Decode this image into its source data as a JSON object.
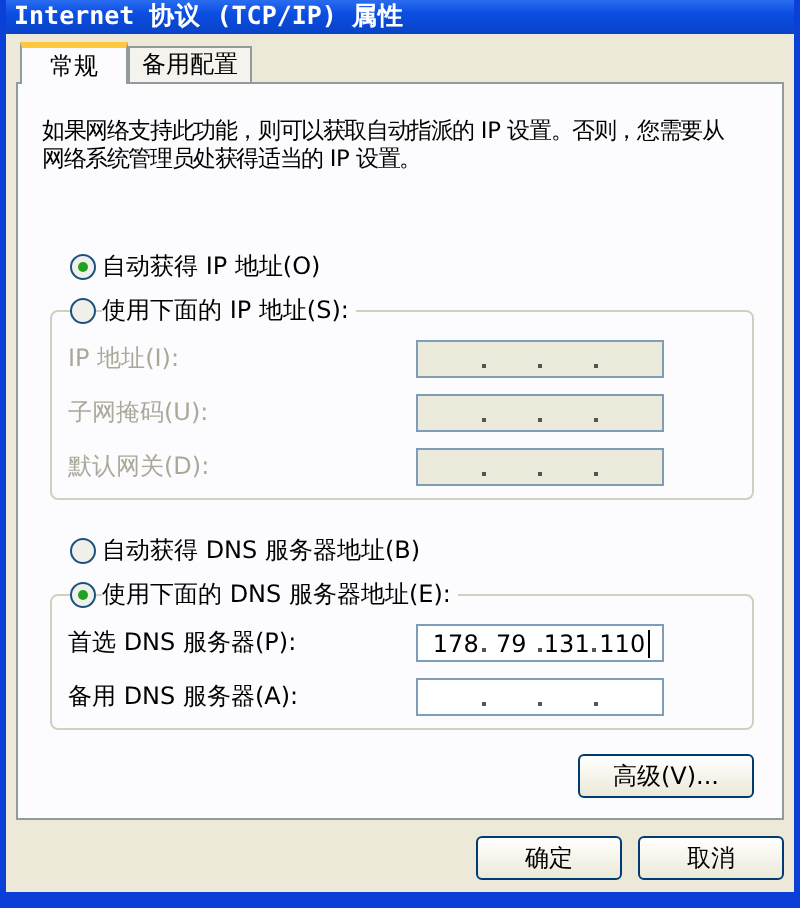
{
  "window": {
    "title": "Internet 协议 (TCP/IP) 属性"
  },
  "tabs": [
    {
      "label": "常规",
      "selected": true
    },
    {
      "label": "备用配置",
      "selected": false
    }
  ],
  "description": "如果网络支持此功能，则可以获取自动指派的 IP 设置。否则，您需要从网络系统管理员处获得适当的 IP 设置。",
  "sections": [
    {
      "auto_option": {
        "label": "自动获得 IP 地址(O)",
        "selected": true
      },
      "manual_option": {
        "label": "使用下面的 IP 地址(S):",
        "selected": false
      },
      "disabled": true,
      "fields": [
        {
          "label": "IP 地址(I):"
        },
        {
          "label": "子网掩码(U):"
        },
        {
          "label": "默认网关(D):"
        }
      ]
    },
    {
      "auto_option": {
        "label": "自动获得 DNS 服务器地址(B)",
        "selected": false
      },
      "manual_option": {
        "label": "使用下面的 DNS 服务器地址(E):",
        "selected": true
      },
      "disabled": false,
      "fields": [
        {
          "label": "首选 DNS 服务器(P):",
          "octets": [
            "178",
            "79",
            "131",
            "110"
          ],
          "focused": true
        },
        {
          "label": "备用 DNS 服务器(A):"
        }
      ]
    }
  ],
  "advanced_button": "高级(V)...",
  "buttons": [
    "确定",
    "取消"
  ]
}
